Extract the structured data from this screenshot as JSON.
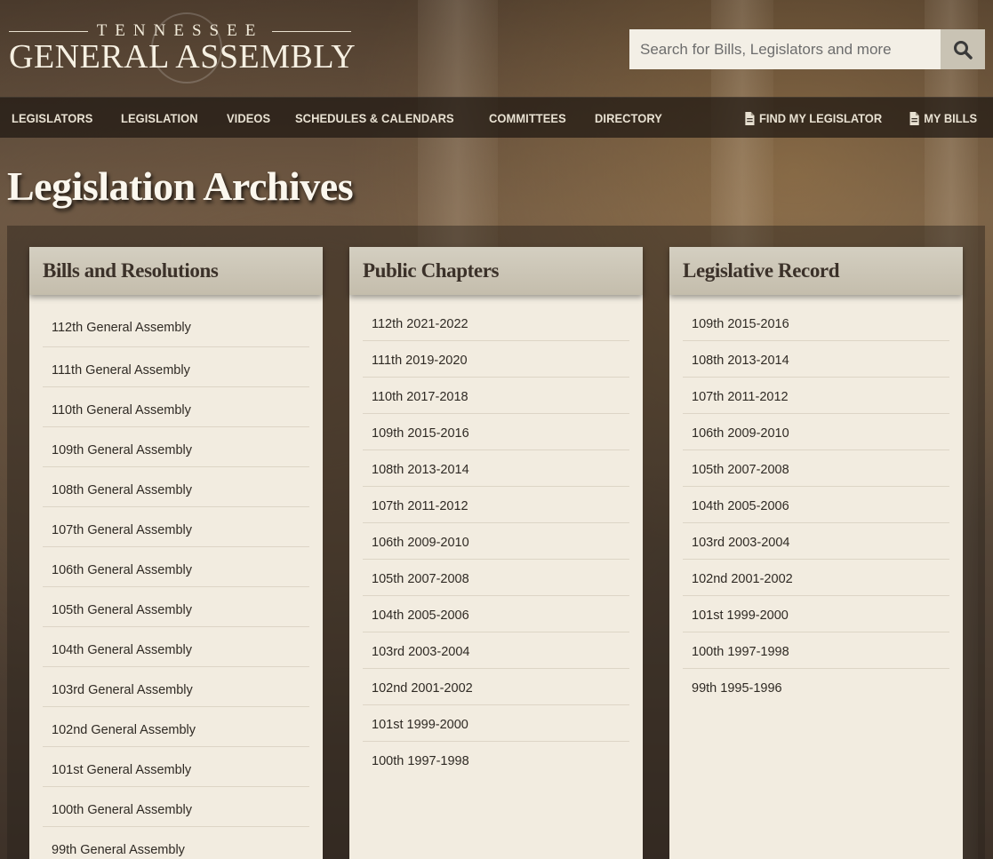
{
  "header": {
    "logo_top": "TENNESSEE",
    "logo_main": "GENERAL ASSEMBLY",
    "search_placeholder": "Search for Bills, Legislators and more"
  },
  "nav": {
    "items": [
      "LEGISLATORS",
      "LEGISLATION",
      "VIDEOS",
      "SCHEDULES & CALENDARS",
      "COMMITTEES",
      "DIRECTORY"
    ],
    "find_legislator": "FIND MY LEGISLATOR",
    "my_bills": "MY BILLS"
  },
  "page": {
    "title": "Legislation Archives"
  },
  "panels": [
    {
      "title": "Bills and Resolutions",
      "items": [
        "112th General Assembly",
        "111th General Assembly",
        "110th General Assembly",
        "109th General Assembly",
        "108th General Assembly",
        "107th General Assembly",
        "106th General Assembly",
        "105th General Assembly",
        "104th General Assembly",
        "103rd General Assembly",
        "102nd General Assembly",
        "101st General Assembly",
        "100th General Assembly",
        "99th General Assembly"
      ]
    },
    {
      "title": "Public Chapters",
      "items": [
        "112th 2021-2022",
        "111th 2019-2020",
        "110th 2017-2018",
        "109th 2015-2016",
        "108th 2013-2014",
        "107th 2011-2012",
        "106th 2009-2010",
        "105th 2007-2008",
        "104th 2005-2006",
        "103rd 2003-2004",
        "102nd 2001-2002",
        "101st 1999-2000",
        "100th 1997-1998"
      ]
    },
    {
      "title": "Legislative Record",
      "items": [
        "109th 2015-2016",
        "108th 2013-2014",
        "107th 2011-2012",
        "106th 2009-2010",
        "105th 2007-2008",
        "104th 2005-2006",
        "103rd 2003-2004",
        "102nd 2001-2002",
        "101st 1999-2000",
        "100th 1997-1998",
        "99th 1995-1996"
      ]
    }
  ]
}
